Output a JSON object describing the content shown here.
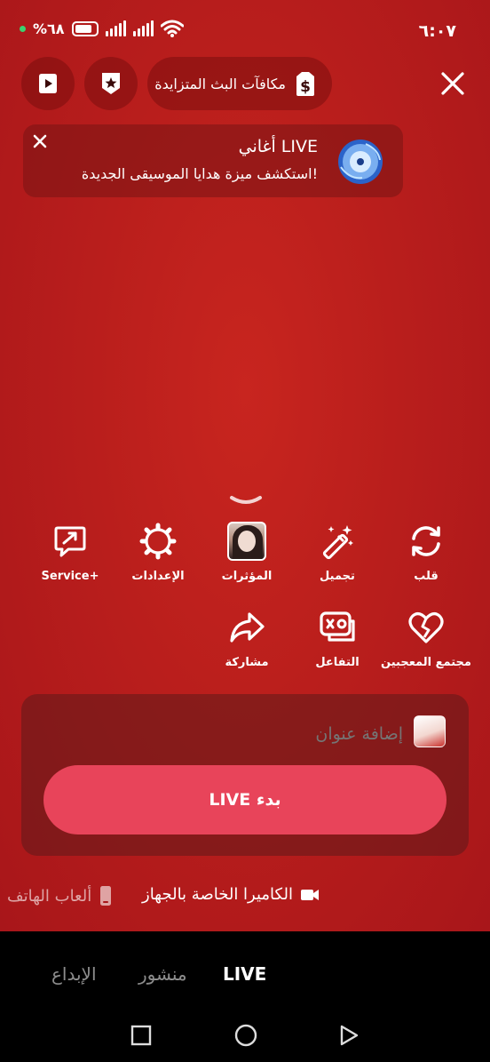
{
  "status_bar": {
    "time": "٦:٠٧",
    "battery": "%٦٨"
  },
  "top": {
    "rewards_label": "مكافآت البث المتزايدة"
  },
  "banner": {
    "title": "أغاني LIVE",
    "subtitle": "استكشف ميزة هدايا الموسيقى الجديدة!"
  },
  "tools": [
    {
      "label": "Service+",
      "icon": "share-box-icon"
    },
    {
      "label": "الإعدادات",
      "icon": "gear-icon"
    },
    {
      "label": "المؤثرات",
      "icon": "effects-thumbnail"
    },
    {
      "label": "تجميل",
      "icon": "magic-wand-icon"
    },
    {
      "label": "قلب",
      "icon": "flip-camera-icon"
    },
    {
      "label": "مشاركة",
      "icon": "share-arrow-icon"
    },
    {
      "label": "التفاعل",
      "icon": "interaction-icon"
    },
    {
      "label": "مجتمع المعجبين",
      "icon": "heart-icon"
    }
  ],
  "panel": {
    "title_placeholder": "إضافة عنوان",
    "go_live_label": "بدء LIVE"
  },
  "sources": {
    "phone_games": "ألعاب الهاتف",
    "device_camera": "الكاميرا الخاصة بالجهاز"
  },
  "mode_tabs": {
    "create": "الإبداع",
    "post": "منشور",
    "live": "LIVE"
  },
  "colors": {
    "background": "#b91e1c",
    "go_live": "#e8445a"
  }
}
